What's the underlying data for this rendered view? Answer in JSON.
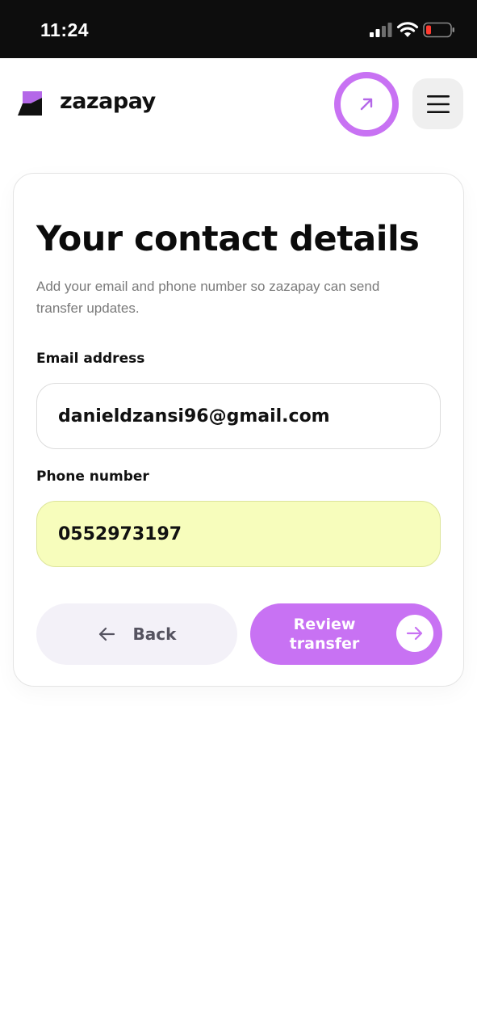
{
  "status_bar": {
    "time": "11:24",
    "icons": [
      "cellular-signal-icon",
      "wifi-icon",
      "battery-low-icon"
    ]
  },
  "header": {
    "brand": "zazapay",
    "logo_icon": "zazapay-logo",
    "action_icon": "arrow-up-right-icon",
    "menu_icon": "hamburger-menu-icon"
  },
  "form": {
    "title": "Your contact details",
    "subtitle": "Add your email and phone number so zazapay can send transfer updates.",
    "email": {
      "label": "Email address",
      "value": "danieldzansi96@gmail.com"
    },
    "phone": {
      "label": "Phone number",
      "value": "0552973197"
    },
    "back_button": {
      "label": "Back",
      "icon": "arrow-left-icon"
    },
    "review_button": {
      "label": "Review transfer",
      "icon": "arrow-right-icon"
    }
  },
  "colors": {
    "accent": "#c872f3",
    "phone_field_bg": "#f7fdbc",
    "back_button_bg": "#f3f1f8"
  }
}
